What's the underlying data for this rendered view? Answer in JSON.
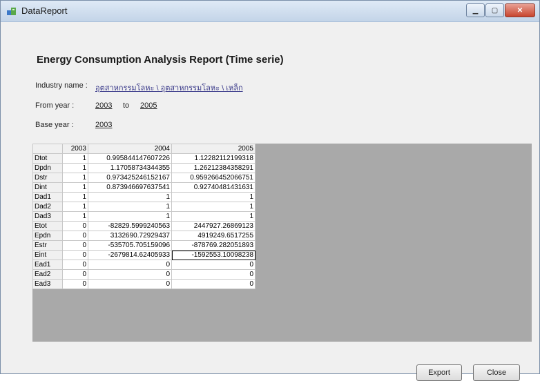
{
  "window": {
    "title": "DataReport"
  },
  "report": {
    "title": "Energy Consumption Analysis Report (Time serie)",
    "industry_label": "Industry name :",
    "industry_value": "อุตสาหกรรมโลหะ \\ อุตสาหกรรมโลหะ \\ เหล็ก",
    "from_label": "From year :",
    "from_value": "2003",
    "to_label": "to",
    "to_value": "2005",
    "base_label": "Base year :",
    "base_value": "2003"
  },
  "table": {
    "columns": [
      "2003",
      "2004",
      "2005"
    ],
    "rows": [
      {
        "label": "Dtot",
        "values": [
          "1",
          "0.995844147607226",
          "1.12282112199318"
        ]
      },
      {
        "label": "Dpdn",
        "values": [
          "1",
          "1.17058734344355",
          "1.26212384358291"
        ]
      },
      {
        "label": "Dstr",
        "values": [
          "1",
          "0.973425246152167",
          "0.959266452066751"
        ]
      },
      {
        "label": "Dint",
        "values": [
          "1",
          "0.873946697637541",
          "0.92740481431631"
        ]
      },
      {
        "label": "Dad1",
        "values": [
          "1",
          "1",
          "1"
        ]
      },
      {
        "label": "Dad2",
        "values": [
          "1",
          "1",
          "1"
        ]
      },
      {
        "label": "Dad3",
        "values": [
          "1",
          "1",
          "1"
        ]
      },
      {
        "label": "Etot",
        "values": [
          "0",
          "-82829.5999240563",
          "2447927.26869123"
        ]
      },
      {
        "label": "Epdn",
        "values": [
          "0",
          "3132690.72929437",
          "4919249.6517255"
        ]
      },
      {
        "label": "Estr",
        "values": [
          "0",
          "-535705.705159096",
          "-878769.282051893"
        ]
      },
      {
        "label": "Eint",
        "values": [
          "0",
          "-2679814.62405933",
          "-1592553.10098238"
        ]
      },
      {
        "label": "Ead1",
        "values": [
          "0",
          "0",
          "0"
        ]
      },
      {
        "label": "Ead2",
        "values": [
          "0",
          "0",
          "0"
        ]
      },
      {
        "label": "Ead3",
        "values": [
          "0",
          "0",
          "0"
        ]
      }
    ]
  },
  "buttons": {
    "export": "Export",
    "close": "Close"
  },
  "icons": {
    "app": "report-icon",
    "minimize": "minimize-icon",
    "maximize": "maximize-icon",
    "close": "close-icon"
  }
}
